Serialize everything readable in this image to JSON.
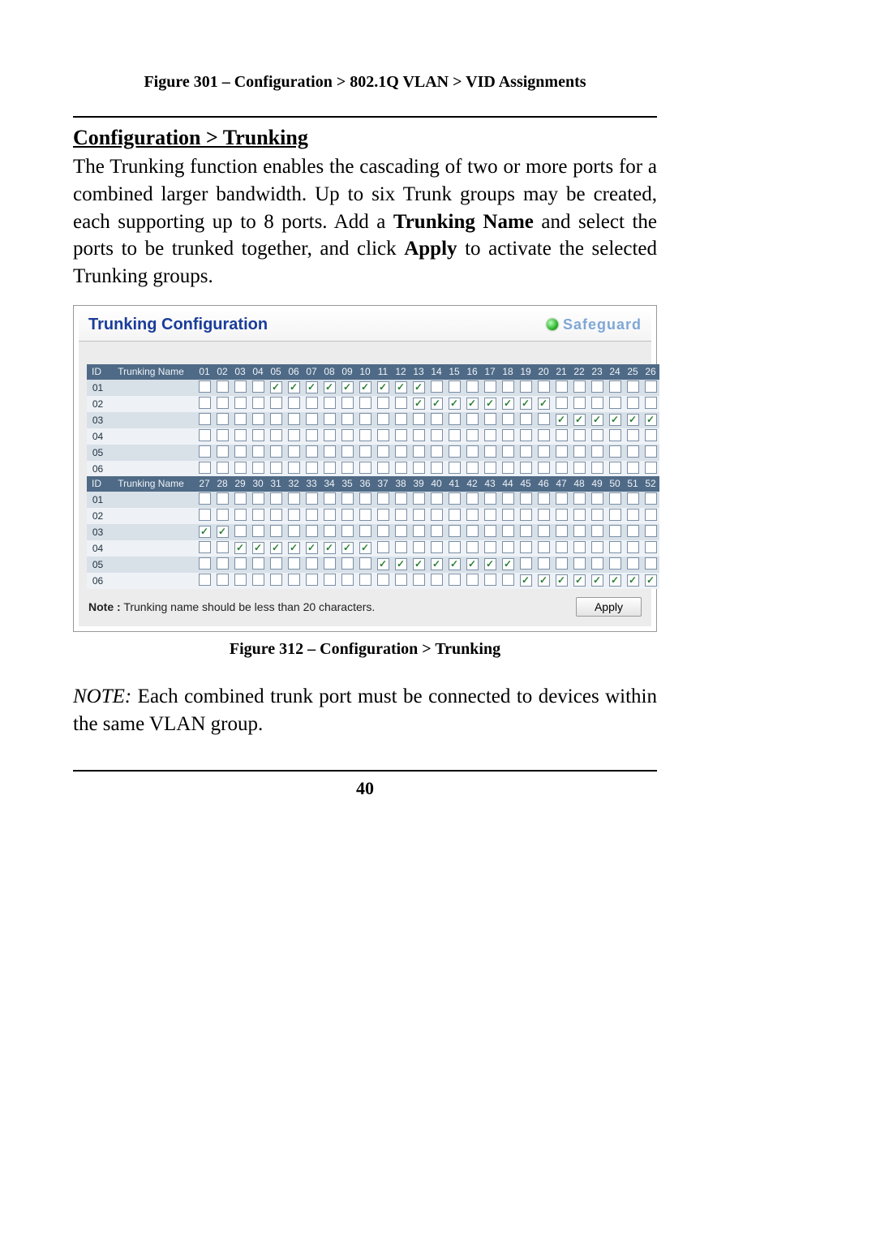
{
  "caption_top": "Figure 301 – Configuration > 802.1Q VLAN > VID Assignments",
  "section_heading": "Configuration > Trunking",
  "body_html": "The Trunking function enables the cascading of two or more ports for a combined larger bandwidth. Up to six Trunk groups may be created, each supporting up to 8 ports. Add a <b>Trunking Name</b> and select the ports to be trunked together, and click <b>Apply</b> to activate the selected Trunking groups.",
  "panel": {
    "title": "Trunking Configuration",
    "safeguard": "Safeguard",
    "headers": {
      "id": "ID",
      "name": "Trunking Name"
    },
    "table1": {
      "ports": [
        "01",
        "02",
        "03",
        "04",
        "05",
        "06",
        "07",
        "08",
        "09",
        "10",
        "11",
        "12",
        "13",
        "14",
        "15",
        "16",
        "17",
        "18",
        "19",
        "20",
        "21",
        "22",
        "23",
        "24",
        "25",
        "26"
      ],
      "rows": [
        {
          "id": "01",
          "checked": [
            "05",
            "06",
            "07",
            "08",
            "09",
            "10",
            "11",
            "12",
            "13"
          ]
        },
        {
          "id": "02",
          "checked": [
            "13",
            "14",
            "15",
            "16",
            "17",
            "18",
            "19",
            "20"
          ]
        },
        {
          "id": "03",
          "checked": [
            "21",
            "22",
            "23",
            "24",
            "25",
            "26"
          ]
        },
        {
          "id": "04",
          "checked": []
        },
        {
          "id": "05",
          "checked": []
        },
        {
          "id": "06",
          "checked": []
        }
      ]
    },
    "table2": {
      "ports": [
        "27",
        "28",
        "29",
        "30",
        "31",
        "32",
        "33",
        "34",
        "35",
        "36",
        "37",
        "38",
        "39",
        "40",
        "41",
        "42",
        "43",
        "44",
        "45",
        "46",
        "47",
        "48",
        "49",
        "50",
        "51",
        "52"
      ],
      "rows": [
        {
          "id": "01",
          "checked": []
        },
        {
          "id": "02",
          "checked": []
        },
        {
          "id": "03",
          "checked": [
            "27",
            "28"
          ]
        },
        {
          "id": "04",
          "checked": [
            "29",
            "30",
            "31",
            "32",
            "33",
            "34",
            "35",
            "36"
          ]
        },
        {
          "id": "05",
          "checked": [
            "37",
            "38",
            "39",
            "40",
            "41",
            "42",
            "43",
            "44"
          ]
        },
        {
          "id": "06",
          "checked": [
            "45",
            "46",
            "47",
            "48",
            "49",
            "50",
            "51",
            "52"
          ]
        }
      ]
    },
    "note": "Trunking name should be less than 20 characters.",
    "note_label": "Note :",
    "apply": "Apply"
  },
  "caption_bottom": "Figure 312 – Configuration > Trunking",
  "note_html": "<i>NOTE:</i>  Each combined trunk port must be connected to devices within the same VLAN group.",
  "page_number": "40"
}
